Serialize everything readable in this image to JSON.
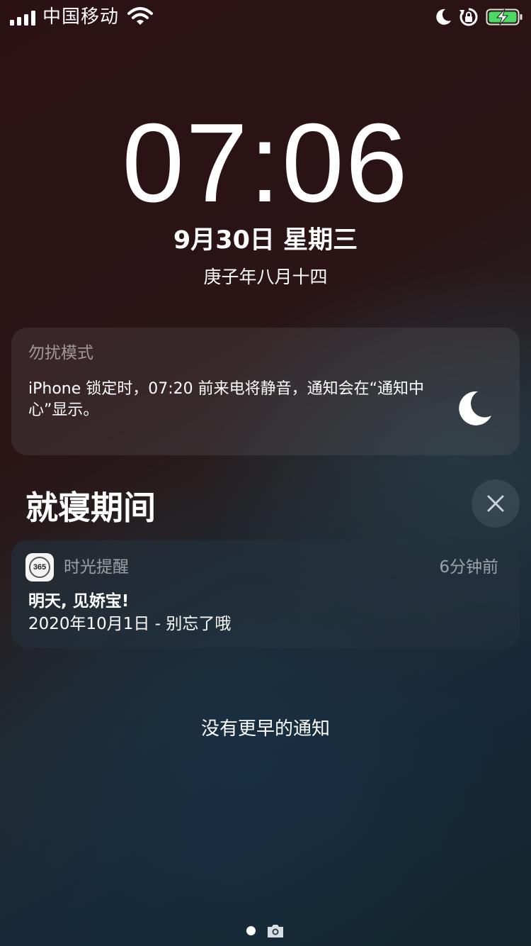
{
  "status_bar": {
    "carrier": "中国移动",
    "icons": [
      "signal-bars-icon",
      "wifi-icon",
      "moon-icon",
      "rotation-lock-icon",
      "battery-charging-icon"
    ],
    "battery_color": "#4cd964"
  },
  "lock_screen": {
    "time": "07:06",
    "date": "9月30日 星期三",
    "lunar_date": "庚子年八月十四"
  },
  "dnd_card": {
    "title": "勿扰模式",
    "message": "iPhone 锁定时，07:20 前来电将静音，通知会在“通知中心”显示。",
    "icon": "moon-icon"
  },
  "section": {
    "title": "就寝期间",
    "clear_icon": "close-icon"
  },
  "notification": {
    "app_name": "时光提醒",
    "app_icon_text": "365",
    "time_ago": "6分钟前",
    "title": "明天, 见娇宝!",
    "body": "2020年10月1日 - 别忘了哦"
  },
  "footer": {
    "no_earlier_text": "没有更早的通知",
    "page_indicator_icons": [
      "page-dot-icon",
      "camera-icon"
    ]
  },
  "colors": {
    "background_top": "#2c1114",
    "background_bottom": "#17293a",
    "text_primary": "#ffffff"
  }
}
